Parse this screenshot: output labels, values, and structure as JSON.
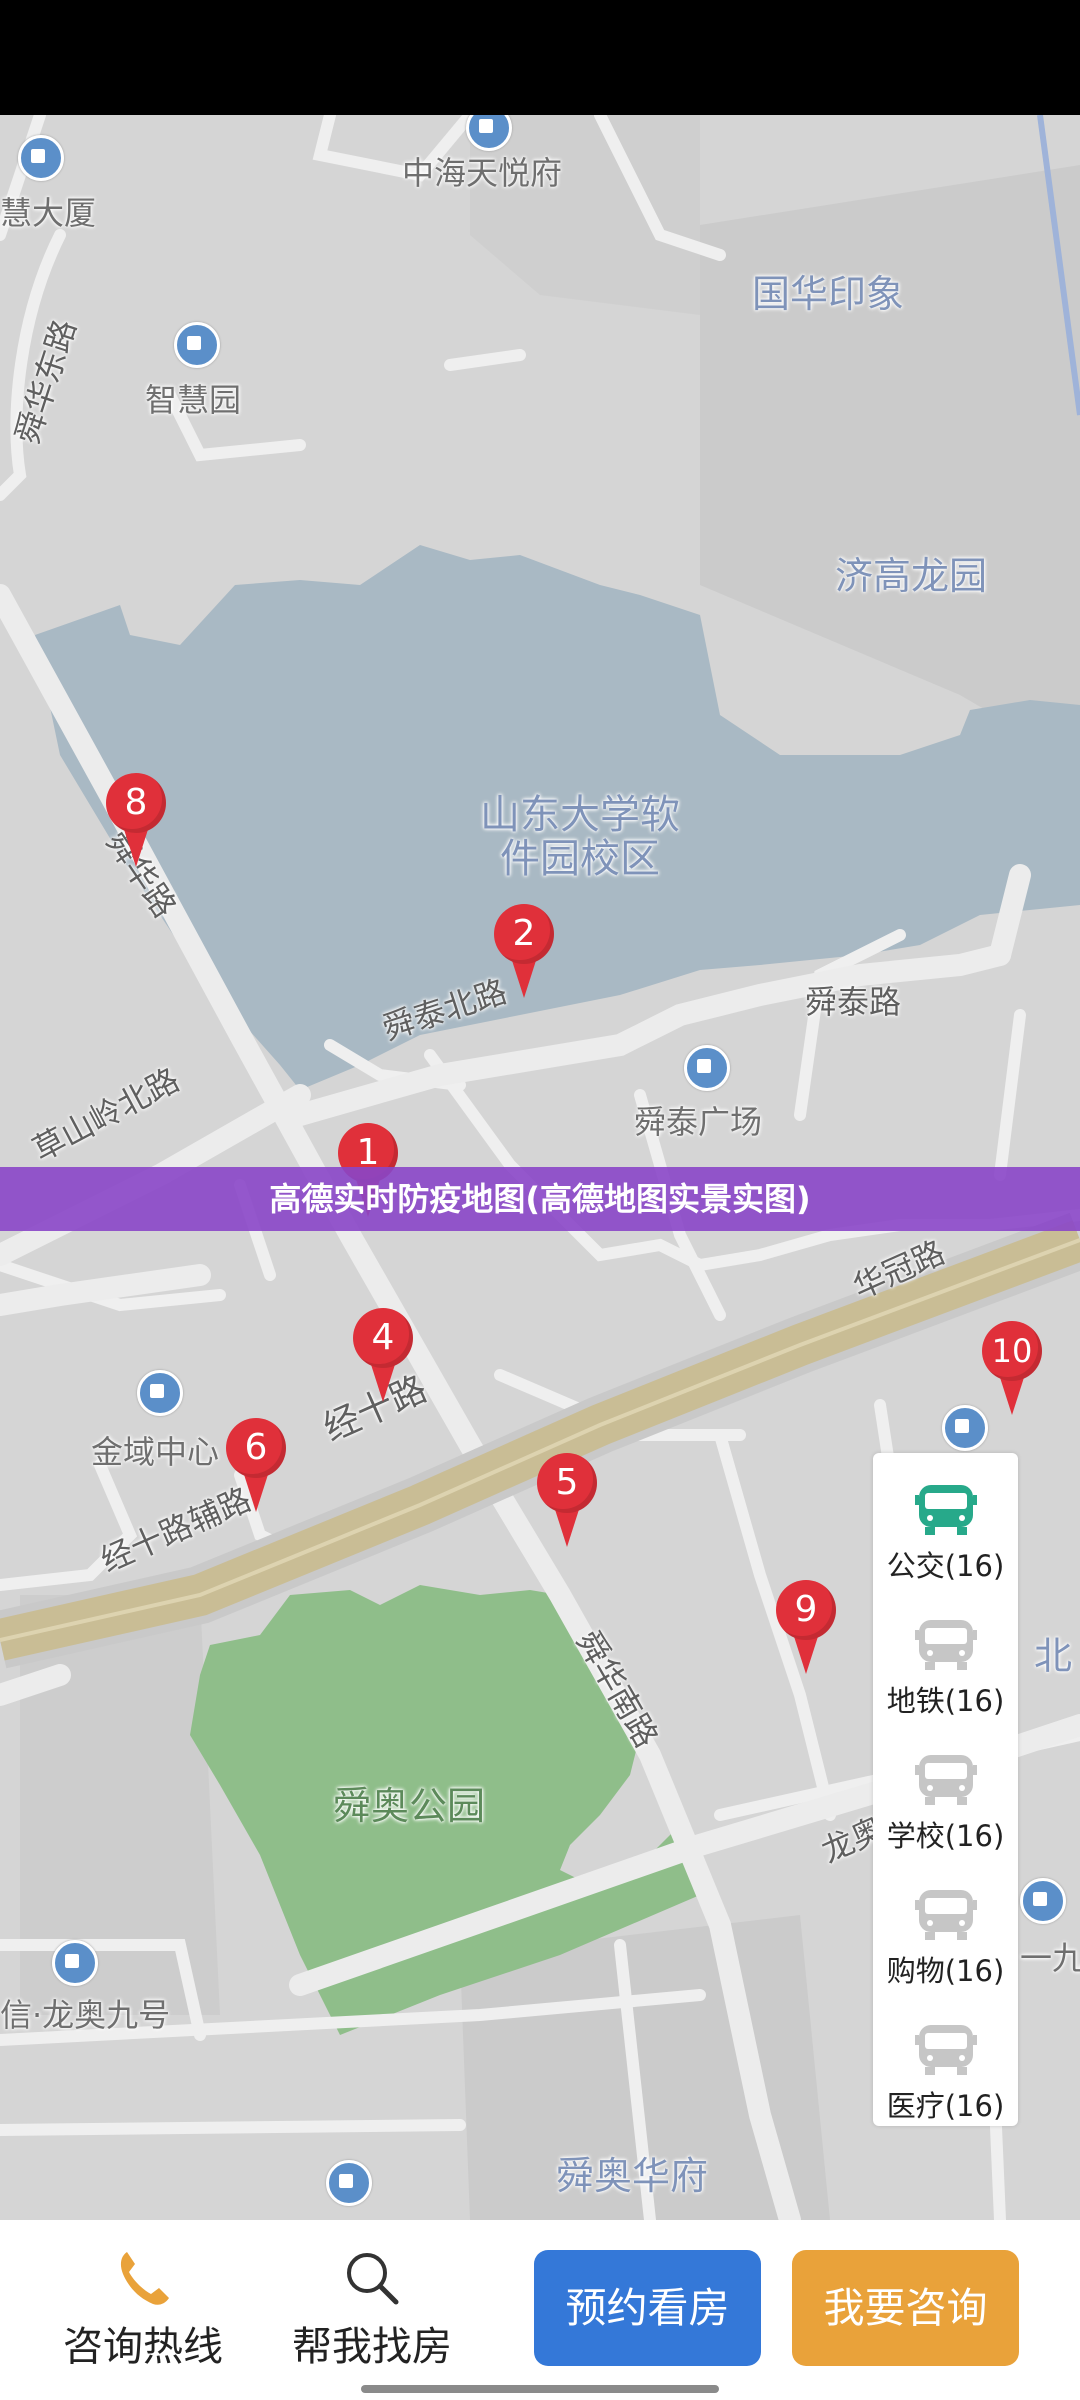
{
  "map": {
    "labels": {
      "zhonghai": "中海天悦府",
      "huida": "慧大厦",
      "guohua": "国华印象",
      "zhihuiyuan": "智慧园",
      "shunhuadong": "舜华东路",
      "jigao": "济高龙园",
      "campus": "山东大学软件园校区",
      "shunhua": "舜华路",
      "shuntaibei": "舜泰北路",
      "shuntai": "舜泰路",
      "caoshanling": "草山岭北路",
      "shuntaiguangchang": "舜泰广场",
      "huaguan": "华冠路",
      "jinyu": "金域中心",
      "jingshi": "经十路",
      "jingshifu": "经十路辅路",
      "shunhuanan": "舜华南路",
      "shunaopark": "舜奥公园",
      "long": "龙奥",
      "bei": "北",
      "longao9": "信·龙奥九号",
      "yijiu": "一九",
      "shunaohua": "舜奥华府"
    },
    "pins": [
      "8",
      "2",
      "1",
      "4",
      "6",
      "5",
      "9",
      "10"
    ]
  },
  "banner": "高德实时防疫地图(高德地图实景实图)",
  "side_panel": {
    "categories": [
      {
        "label": "公交(16)",
        "active": true
      },
      {
        "label": "地铁(16)",
        "active": false
      },
      {
        "label": "学校(16)",
        "active": false
      },
      {
        "label": "购物(16)",
        "active": false
      },
      {
        "label": "医疗(16)",
        "active": false
      }
    ],
    "active_color": "#27a98a",
    "inactive_color": "#c6c6c6"
  },
  "bottom_bar": {
    "hotline": "咨询热线",
    "find_house": "帮我找房",
    "book_view": "预约看房",
    "consult": "我要咨询",
    "book_color": "#3478d8",
    "consult_color": "#e9a23a"
  }
}
